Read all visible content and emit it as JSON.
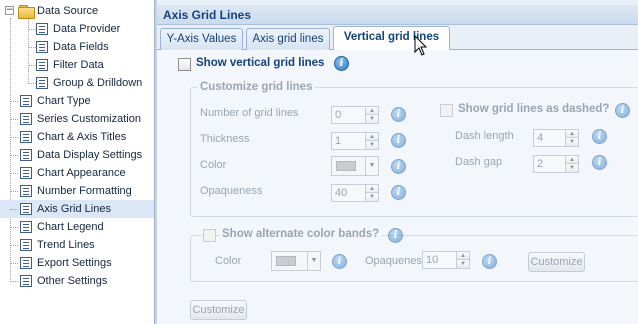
{
  "tree": {
    "items": [
      {
        "label": "Data Source",
        "level": 0,
        "icon": "folder-icon",
        "expanded": true
      },
      {
        "label": "Data Provider",
        "level": 1,
        "icon": "doc-icon"
      },
      {
        "label": "Data Fields",
        "level": 1,
        "icon": "doc-icon"
      },
      {
        "label": "Filter Data",
        "level": 1,
        "icon": "doc-icon"
      },
      {
        "label": "Group & Drilldown",
        "level": 1,
        "icon": "doc-icon"
      },
      {
        "label": "Chart Type",
        "level": 0,
        "icon": "doc-icon"
      },
      {
        "label": "Series Customization",
        "level": 0,
        "icon": "doc-icon"
      },
      {
        "label": "Chart & Axis Titles",
        "level": 0,
        "icon": "doc-icon"
      },
      {
        "label": "Data Display Settings",
        "level": 0,
        "icon": "doc-icon"
      },
      {
        "label": "Chart Appearance",
        "level": 0,
        "icon": "doc-icon"
      },
      {
        "label": "Number Formatting",
        "level": 0,
        "icon": "doc-icon"
      },
      {
        "label": "Axis Grid Lines",
        "level": 0,
        "icon": "doc-icon",
        "selected": true
      },
      {
        "label": "Chart Legend",
        "level": 0,
        "icon": "doc-icon"
      },
      {
        "label": "Trend Lines",
        "level": 0,
        "icon": "doc-icon"
      },
      {
        "label": "Export Settings",
        "level": 0,
        "icon": "doc-icon"
      },
      {
        "label": "Other Settings",
        "level": 0,
        "icon": "doc-icon"
      }
    ]
  },
  "panel": {
    "title": "Axis Grid Lines",
    "tabs": [
      "Y-Axis Values",
      "Axis grid lines",
      "Vertical grid lines"
    ],
    "active_tab": "Vertical grid lines"
  },
  "vertical": {
    "show_label": "Show vertical grid lines",
    "show_checked": false,
    "customize_group": "Customize grid lines",
    "number_label": "Number of grid lines",
    "number_value": "0",
    "thickness_label": "Thickness",
    "thickness_value": "1",
    "color_label": "Color",
    "opaqueness_label": "Opaqueness",
    "opaqueness_value": "40",
    "dashed_label": "Show grid lines as dashed?",
    "dash_length_label": "Dash length",
    "dash_length_value": "4",
    "dash_gap_label": "Dash gap",
    "dash_gap_value": "2",
    "alt_bands_label": "Show alternate color bands?",
    "alt_color_label": "Color",
    "alt_opaqueness_label": "Opaqueness",
    "alt_opaqueness_value": "10",
    "alt_customize_button": "Customize",
    "customize_button": "Customize"
  },
  "colors": {
    "accent": "#15427a",
    "selection": "#dbe7f6",
    "disabled_text": "#9aa6b2"
  }
}
